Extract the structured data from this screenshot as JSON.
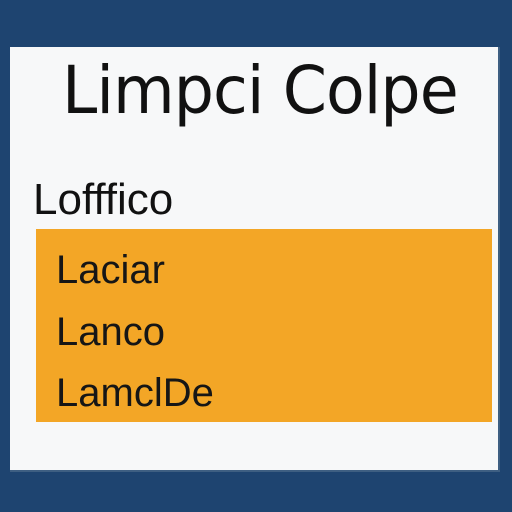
{
  "window": {
    "title": "Limpci Colpe"
  },
  "section": {
    "heading": "Lofffico",
    "items": [
      {
        "label": "Laciar"
      },
      {
        "label": "Lanco"
      },
      {
        "label": "LamclDe"
      }
    ]
  },
  "colors": {
    "background": "#1e4470",
    "panel": "#f7f8f9",
    "selection": "#f3a626"
  }
}
